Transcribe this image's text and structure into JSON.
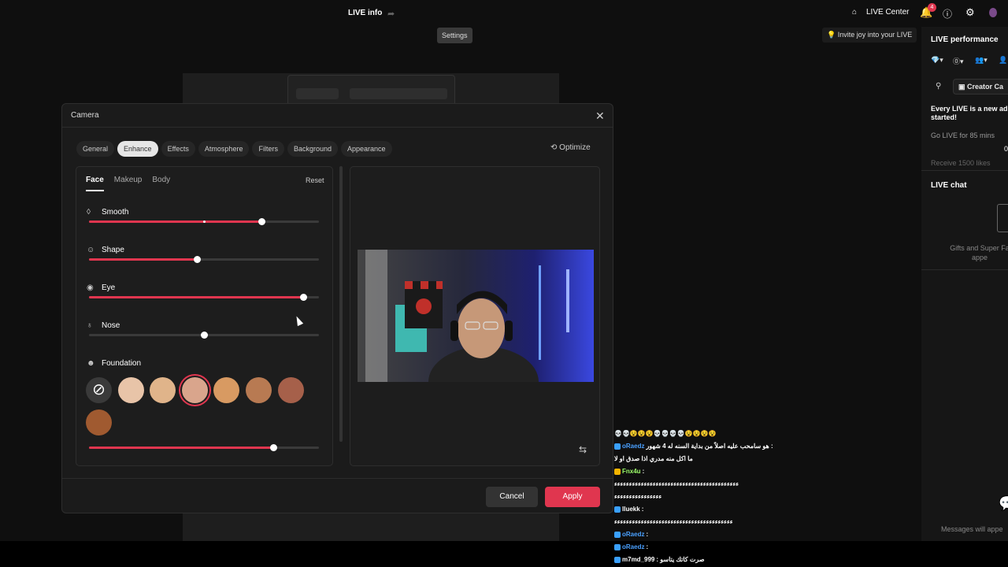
{
  "topbar": {
    "live_info": "LIVE info",
    "settings_tooltip": "Settings",
    "live_center": "LIVE Center",
    "notification_count": "4",
    "invite": "Invite joy into your LIVE"
  },
  "right_panel": {
    "performance_title": "LIVE performance",
    "creator_button": "Creator Ca",
    "every_live": "Every LIVE is a new ad",
    "started": "started!",
    "go_live": "Go LIVE for 85 mins",
    "go_live_value": "0",
    "receive_likes": "Receive 1500 likes",
    "chat_title": "LIVE chat",
    "gifts_text_1": "Gifts and Super Fa",
    "gifts_text_2": "appe",
    "messages_text": "Messages will appe"
  },
  "dialog": {
    "title": "Camera",
    "tabs": [
      "General",
      "Enhance",
      "Effects",
      "Atmosphere",
      "Filters",
      "Background",
      "Appearance"
    ],
    "active_tab": "Enhance",
    "optimize": "Optimize",
    "subtabs": [
      "Face",
      "Makeup",
      "Body"
    ],
    "active_subtab": "Face",
    "reset": "Reset",
    "params": [
      {
        "label": "Smooth",
        "icon": "drop-icon",
        "value": 0.75,
        "default": 0.5
      },
      {
        "label": "Shape",
        "icon": "face-shape-icon",
        "value": 0.47
      },
      {
        "label": "Eye",
        "icon": "eye-icon",
        "value": 0.93
      },
      {
        "label": "Nose",
        "icon": "nose-icon",
        "value": 0.5,
        "neutral": true
      }
    ],
    "foundation_label": "Foundation",
    "foundation_value": 0.8,
    "swatches": [
      "#e8c4a8",
      "#e0b48a",
      "#d9a58c",
      "#d89a62",
      "#b87a52",
      "#a6604a",
      "#a05a30"
    ],
    "selected_swatch": 2,
    "cancel": "Cancel",
    "apply": "Apply"
  },
  "chat": [
    {
      "user": "",
      "text": "💀💀😵😵😵💀💀💀💀😵😵😵😵"
    },
    {
      "user": "oRaedz",
      "text": "هو سامحب عليه اصلاً من بداية السنه له 4 شهور :"
    },
    {
      "user": "",
      "text": "ما اكل منه مدري اذا صدق او لا"
    },
    {
      "user": "Fnx4u",
      "text": ":"
    },
    {
      "user": "",
      "text": "ﺀﺀﺀﺀﺀﺀﺀﺀﺀﺀﺀﺀﺀﺀﺀﺀﺀﺀﺀﺀﺀﺀﺀﺀﺀﺀﺀﺀﺀﺀﺀﺀﺀﺀﺀﺀﺀﺀﺀﺀﺀﺀ"
    },
    {
      "user": "",
      "text": "ﺀﺀﺀﺀﺀﺀﺀﺀﺀﺀﺀﺀﺀﺀﺀﺀ"
    },
    {
      "user": "lluekk",
      "text": ":"
    },
    {
      "user": "",
      "text": "ﺀﺀﺀﺀﺀﺀﺀﺀﺀﺀﺀﺀﺀﺀﺀﺀﺀﺀﺀﺀﺀﺀﺀﺀﺀﺀﺀﺀﺀﺀﺀﺀﺀﺀﺀﺀﺀﺀﺀﺀ"
    },
    {
      "user": "oRaedz",
      "text": ":"
    },
    {
      "user": "oRaedz",
      "text": ":"
    },
    {
      "user": "m7md_999",
      "text": ": صرت كاتك يتاسو"
    }
  ],
  "colors": {
    "accent": "#e0364f"
  }
}
